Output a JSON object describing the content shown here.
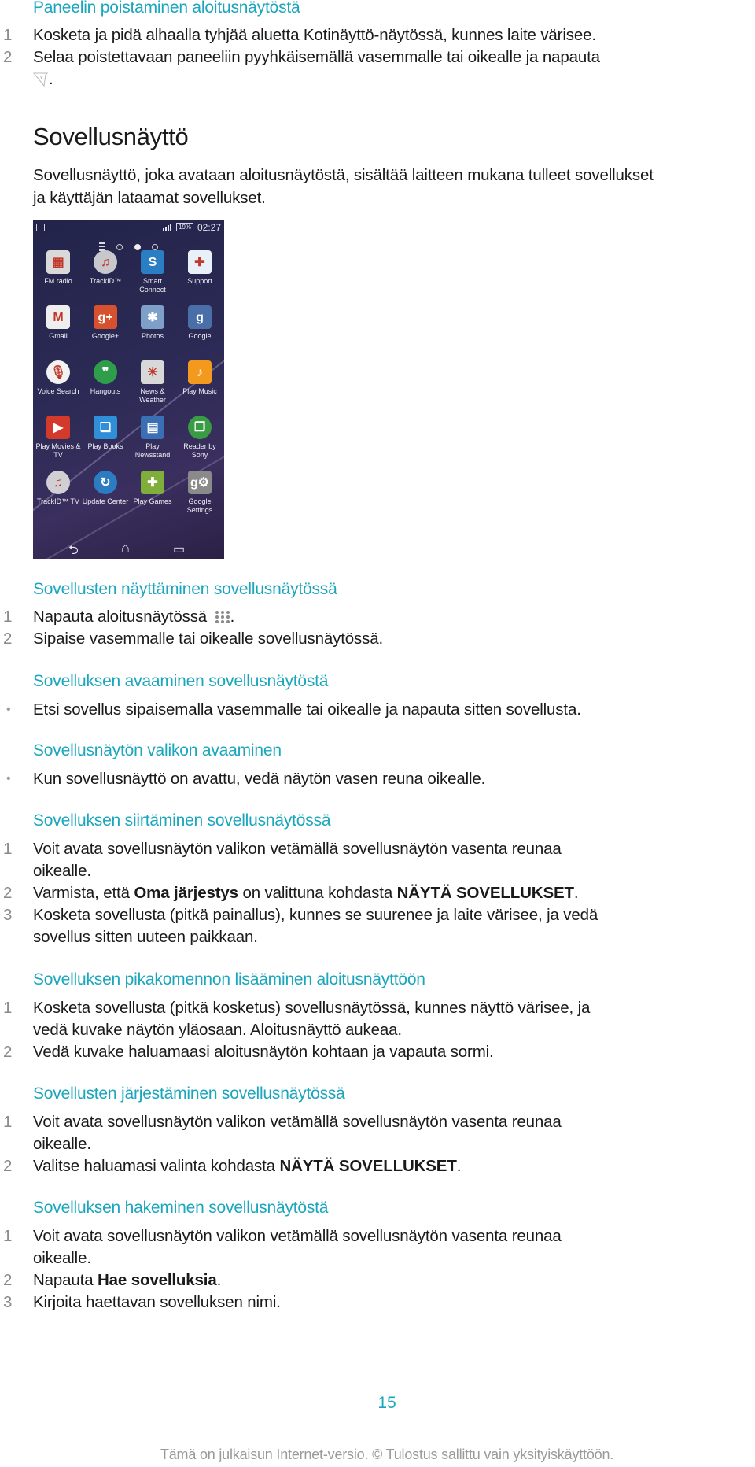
{
  "section_remove_panel": {
    "heading": "Paneelin poistaminen aloitusnäytöstä",
    "steps": [
      {
        "num": "1",
        "text": "Kosketa ja pidä alhaalla tyhjää aluetta Kotinäyttö-näytössä, kunnes laite värisee."
      },
      {
        "num": "2",
        "text": "Selaa poistettavaan paneeliin pyyhkäisemällä vasemmalle tai oikealle ja napauta",
        "icon": "remove-panel-icon",
        "tail": "."
      }
    ]
  },
  "app_screen": {
    "title": "Sovellusnäyttö",
    "intro_line1": "Sovellusnäyttö, joka avataan aloitusnäytöstä, sisältää laitteen mukana tulleet sovellukset",
    "intro_line2": "ja käyttäjän lataamat sovellukset."
  },
  "phone": {
    "status": {
      "battery": "19%",
      "time": "02:27"
    },
    "apps": [
      {
        "label": "FM radio",
        "icon": "radio-icon",
        "color": "#d9d9d9",
        "glyph": "▦"
      },
      {
        "label": "TrackID™",
        "icon": "trackid-icon",
        "color": "#c8c8cc",
        "glyph": "♫"
      },
      {
        "label": "Smart Connect",
        "icon": "smart-connect-icon",
        "color": "#2a7fc4",
        "glyph": "S"
      },
      {
        "label": "Support",
        "icon": "support-icon",
        "color": "#e8f0f8",
        "glyph": "✚"
      },
      {
        "label": "Gmail",
        "icon": "gmail-icon",
        "color": "#eeeeee",
        "glyph": "M"
      },
      {
        "label": "Google+",
        "icon": "google-plus-icon",
        "color": "#d8512f",
        "glyph": "g+"
      },
      {
        "label": "Photos",
        "icon": "photos-icon",
        "color": "#7ea0c8",
        "glyph": "✱"
      },
      {
        "label": "Google",
        "icon": "google-icon",
        "color": "#4a6ea8",
        "glyph": "g"
      },
      {
        "label": "Voice Search",
        "icon": "voice-search-icon",
        "color": "#f2f2f2",
        "glyph": "🎙"
      },
      {
        "label": "Hangouts",
        "icon": "hangouts-icon",
        "color": "#2f9d4a",
        "glyph": "❞"
      },
      {
        "label": "News & Weather",
        "icon": "news-weather-icon",
        "color": "#d8d8d8",
        "glyph": "☀"
      },
      {
        "label": "Play Music",
        "icon": "play-music-icon",
        "color": "#f39a1e",
        "glyph": "♪"
      },
      {
        "label": "Play Movies & TV",
        "icon": "play-movies-icon",
        "color": "#d33a2c",
        "glyph": "▶"
      },
      {
        "label": "Play Books",
        "icon": "play-books-icon",
        "color": "#2f8fd8",
        "glyph": "❏"
      },
      {
        "label": "Play Newsstand",
        "icon": "play-newsstand-icon",
        "color": "#3b6fb5",
        "glyph": "▤"
      },
      {
        "label": "Reader by Sony",
        "icon": "reader-icon",
        "color": "#3a9b45",
        "glyph": "❐"
      },
      {
        "label": "TrackID™ TV",
        "icon": "trackid-tv-icon",
        "color": "#d0d0d4",
        "glyph": "♫"
      },
      {
        "label": "Update Center",
        "icon": "update-center-icon",
        "color": "#2d7bc0",
        "glyph": "↻"
      },
      {
        "label": "Play Games",
        "icon": "play-games-icon",
        "color": "#7fae3a",
        "glyph": "✚"
      },
      {
        "label": "Google Settings",
        "icon": "google-settings-icon",
        "color": "#8a8a8a",
        "glyph": "g⚙"
      }
    ],
    "nav": {
      "back": "⮌",
      "home": "⌂",
      "recent": "▭"
    }
  },
  "sections": [
    {
      "heading": "Sovellusten näyttäminen sovellusnäytössä",
      "type": "numbered",
      "steps": [
        {
          "num": "1",
          "text": "Napauta aloitusnäytössä",
          "icon": "apps-grid-icon",
          "tail": "."
        },
        {
          "num": "2",
          "text": "Sipaise vasemmalle tai oikealle sovellusnäytössä."
        }
      ]
    },
    {
      "heading": "Sovelluksen avaaminen sovellusnäytöstä",
      "type": "bullet",
      "steps": [
        {
          "text": "Etsi sovellus sipaisemalla vasemmalle tai oikealle ja napauta sitten sovellusta."
        }
      ]
    },
    {
      "heading": "Sovellusnäytön valikon avaaminen",
      "type": "bullet",
      "steps": [
        {
          "text": "Kun sovellusnäyttö on avattu, vedä näytön vasen reuna oikealle."
        }
      ]
    },
    {
      "heading": "Sovelluksen siirtäminen sovellusnäytössä",
      "type": "numbered",
      "steps": [
        {
          "num": "1",
          "line1": "Voit avata sovellusnäytön valikon vetämällä sovellusnäytön vasenta reunaa",
          "line2": "oikealle."
        },
        {
          "num": "2",
          "pre": "Varmista, että ",
          "bold1": "Oma järjestys",
          "mid": " on valittuna kohdasta ",
          "bold2": "NÄYTÄ SOVELLUKSET",
          "tail": "."
        },
        {
          "num": "3",
          "line1": "Kosketa sovellusta (pitkä painallus), kunnes se suurenee ja laite värisee, ja vedä",
          "line2": "sovellus sitten uuteen paikkaan."
        }
      ]
    },
    {
      "heading": "Sovelluksen pikakomennon lisääminen aloitusnäyttöön",
      "type": "numbered",
      "steps": [
        {
          "num": "1",
          "line1": "Kosketa sovellusta (pitkä kosketus) sovellusnäytössä, kunnes näyttö värisee, ja",
          "line2": "vedä kuvake näytön yläosaan. Aloitusnäyttö aukeaa."
        },
        {
          "num": "2",
          "line1": "Vedä kuvake haluamaasi aloitusnäytön kohtaan ja vapauta sormi."
        }
      ]
    },
    {
      "heading": "Sovellusten järjestäminen sovellusnäytössä",
      "type": "numbered",
      "steps": [
        {
          "num": "1",
          "line1": "Voit avata sovellusnäytön valikon vetämällä sovellusnäytön vasenta reunaa",
          "line2": "oikealle."
        },
        {
          "num": "2",
          "pre": "Valitse haluamasi valinta kohdasta ",
          "bold1": "NÄYTÄ SOVELLUKSET",
          "tail": "."
        }
      ]
    },
    {
      "heading": "Sovelluksen hakeminen sovellusnäytöstä",
      "type": "numbered",
      "steps": [
        {
          "num": "1",
          "line1": "Voit avata sovellusnäytön valikon vetämällä sovellusnäytön vasenta reunaa",
          "line2": "oikealle."
        },
        {
          "num": "2",
          "pre": "Napauta ",
          "bold1": "Hae sovelluksia",
          "tail": "."
        },
        {
          "num": "3",
          "line1": "Kirjoita haettavan sovelluksen nimi."
        }
      ]
    }
  ],
  "footer": {
    "page_number": "15",
    "notice": "Tämä on julkaisun Internet-versio. © Tulostus sallittu vain yksityiskäyttöön."
  },
  "colors": {
    "accent": "#1aa6bd",
    "text": "#1a1a1a",
    "muted": "#8a8a8a"
  }
}
